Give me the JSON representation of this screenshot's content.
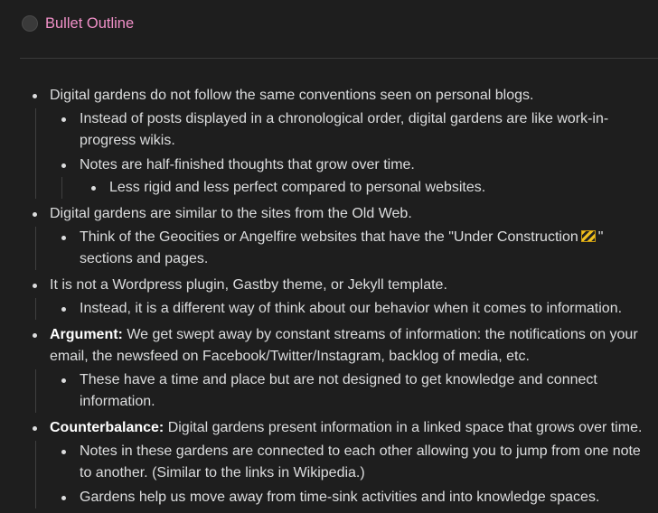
{
  "header": {
    "title": "Bullet Outline"
  },
  "outline": {
    "items": [
      {
        "text": "Digital gardens do not follow the same conventions seen on personal blogs.",
        "children": [
          {
            "text": "Instead of posts displayed in a chronological order, digital gardens are like work-in-progress wikis."
          },
          {
            "text": "Notes are half-finished thoughts that grow over time.",
            "children": [
              {
                "text": "Less rigid and less perfect compared to personal websites."
              }
            ]
          }
        ]
      },
      {
        "text": "Digital gardens are similar to the sites from the Old Web.",
        "children": [
          {
            "text_before": "Think of the Geocities or Angelfire websites that have the \"Under Construction",
            "text_after": "\" sections and pages.",
            "icon": "construction-icon"
          }
        ]
      },
      {
        "text": "It is not a Wordpress plugin, Gastby theme, or Jekyll template.",
        "children": [
          {
            "text": "Instead, it is a different way of think about our behavior when it comes to information."
          }
        ]
      },
      {
        "label": "Argument:",
        "text": " We get swept away by constant streams of information: the notifications on your email, the newsfeed on Facebook/Twitter/Instagram, backlog of media, etc.",
        "children": [
          {
            "text": "These have a time and place but are not designed to get knowledge and connect information."
          }
        ]
      },
      {
        "label": "Counterbalance:",
        "text": " Digital gardens present information in a linked space that grows over time.",
        "children": [
          {
            "text": "Notes in these gardens are connected to each other allowing you to jump from one note to another. (Similar to the links in Wikipedia.)"
          },
          {
            "text": "Gardens help us move away from time-sink activities and into knowledge spaces."
          }
        ]
      }
    ]
  }
}
